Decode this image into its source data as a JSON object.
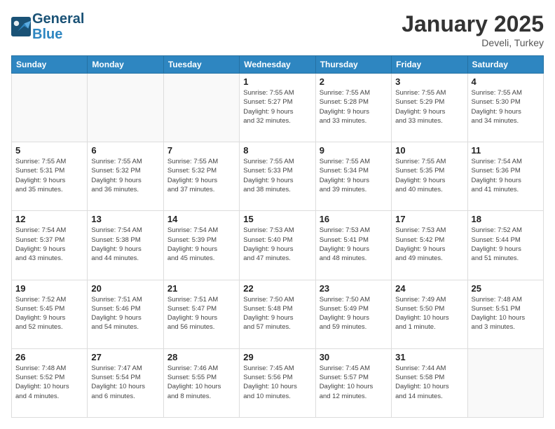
{
  "header": {
    "logo_line1": "General",
    "logo_line2": "Blue",
    "month": "January 2025",
    "location": "Develi, Turkey"
  },
  "weekdays": [
    "Sunday",
    "Monday",
    "Tuesday",
    "Wednesday",
    "Thursday",
    "Friday",
    "Saturday"
  ],
  "weeks": [
    [
      {
        "day": "",
        "info": ""
      },
      {
        "day": "",
        "info": ""
      },
      {
        "day": "",
        "info": ""
      },
      {
        "day": "1",
        "info": "Sunrise: 7:55 AM\nSunset: 5:27 PM\nDaylight: 9 hours\nand 32 minutes."
      },
      {
        "day": "2",
        "info": "Sunrise: 7:55 AM\nSunset: 5:28 PM\nDaylight: 9 hours\nand 33 minutes."
      },
      {
        "day": "3",
        "info": "Sunrise: 7:55 AM\nSunset: 5:29 PM\nDaylight: 9 hours\nand 33 minutes."
      },
      {
        "day": "4",
        "info": "Sunrise: 7:55 AM\nSunset: 5:30 PM\nDaylight: 9 hours\nand 34 minutes."
      }
    ],
    [
      {
        "day": "5",
        "info": "Sunrise: 7:55 AM\nSunset: 5:31 PM\nDaylight: 9 hours\nand 35 minutes."
      },
      {
        "day": "6",
        "info": "Sunrise: 7:55 AM\nSunset: 5:32 PM\nDaylight: 9 hours\nand 36 minutes."
      },
      {
        "day": "7",
        "info": "Sunrise: 7:55 AM\nSunset: 5:32 PM\nDaylight: 9 hours\nand 37 minutes."
      },
      {
        "day": "8",
        "info": "Sunrise: 7:55 AM\nSunset: 5:33 PM\nDaylight: 9 hours\nand 38 minutes."
      },
      {
        "day": "9",
        "info": "Sunrise: 7:55 AM\nSunset: 5:34 PM\nDaylight: 9 hours\nand 39 minutes."
      },
      {
        "day": "10",
        "info": "Sunrise: 7:55 AM\nSunset: 5:35 PM\nDaylight: 9 hours\nand 40 minutes."
      },
      {
        "day": "11",
        "info": "Sunrise: 7:54 AM\nSunset: 5:36 PM\nDaylight: 9 hours\nand 41 minutes."
      }
    ],
    [
      {
        "day": "12",
        "info": "Sunrise: 7:54 AM\nSunset: 5:37 PM\nDaylight: 9 hours\nand 43 minutes."
      },
      {
        "day": "13",
        "info": "Sunrise: 7:54 AM\nSunset: 5:38 PM\nDaylight: 9 hours\nand 44 minutes."
      },
      {
        "day": "14",
        "info": "Sunrise: 7:54 AM\nSunset: 5:39 PM\nDaylight: 9 hours\nand 45 minutes."
      },
      {
        "day": "15",
        "info": "Sunrise: 7:53 AM\nSunset: 5:40 PM\nDaylight: 9 hours\nand 47 minutes."
      },
      {
        "day": "16",
        "info": "Sunrise: 7:53 AM\nSunset: 5:41 PM\nDaylight: 9 hours\nand 48 minutes."
      },
      {
        "day": "17",
        "info": "Sunrise: 7:53 AM\nSunset: 5:42 PM\nDaylight: 9 hours\nand 49 minutes."
      },
      {
        "day": "18",
        "info": "Sunrise: 7:52 AM\nSunset: 5:44 PM\nDaylight: 9 hours\nand 51 minutes."
      }
    ],
    [
      {
        "day": "19",
        "info": "Sunrise: 7:52 AM\nSunset: 5:45 PM\nDaylight: 9 hours\nand 52 minutes."
      },
      {
        "day": "20",
        "info": "Sunrise: 7:51 AM\nSunset: 5:46 PM\nDaylight: 9 hours\nand 54 minutes."
      },
      {
        "day": "21",
        "info": "Sunrise: 7:51 AM\nSunset: 5:47 PM\nDaylight: 9 hours\nand 56 minutes."
      },
      {
        "day": "22",
        "info": "Sunrise: 7:50 AM\nSunset: 5:48 PM\nDaylight: 9 hours\nand 57 minutes."
      },
      {
        "day": "23",
        "info": "Sunrise: 7:50 AM\nSunset: 5:49 PM\nDaylight: 9 hours\nand 59 minutes."
      },
      {
        "day": "24",
        "info": "Sunrise: 7:49 AM\nSunset: 5:50 PM\nDaylight: 10 hours\nand 1 minute."
      },
      {
        "day": "25",
        "info": "Sunrise: 7:48 AM\nSunset: 5:51 PM\nDaylight: 10 hours\nand 3 minutes."
      }
    ],
    [
      {
        "day": "26",
        "info": "Sunrise: 7:48 AM\nSunset: 5:52 PM\nDaylight: 10 hours\nand 4 minutes."
      },
      {
        "day": "27",
        "info": "Sunrise: 7:47 AM\nSunset: 5:54 PM\nDaylight: 10 hours\nand 6 minutes."
      },
      {
        "day": "28",
        "info": "Sunrise: 7:46 AM\nSunset: 5:55 PM\nDaylight: 10 hours\nand 8 minutes."
      },
      {
        "day": "29",
        "info": "Sunrise: 7:45 AM\nSunset: 5:56 PM\nDaylight: 10 hours\nand 10 minutes."
      },
      {
        "day": "30",
        "info": "Sunrise: 7:45 AM\nSunset: 5:57 PM\nDaylight: 10 hours\nand 12 minutes."
      },
      {
        "day": "31",
        "info": "Sunrise: 7:44 AM\nSunset: 5:58 PM\nDaylight: 10 hours\nand 14 minutes."
      },
      {
        "day": "",
        "info": ""
      }
    ]
  ]
}
